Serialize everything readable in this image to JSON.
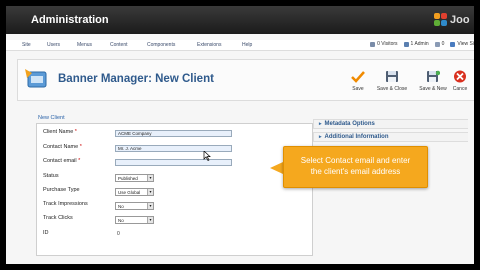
{
  "header": {
    "title": "Administration",
    "logo_text": "Joo"
  },
  "menu": {
    "items": [
      "Site",
      "Users",
      "Menus",
      "Content",
      "Components",
      "Extensions",
      "Help"
    ],
    "visitors": "0 Visitors",
    "admins": "1 Admin",
    "messages": "0",
    "view_site": "View Si"
  },
  "toolbar": {
    "title": "Banner Manager: New Client",
    "save": "Save",
    "save_close": "Save & Close",
    "save_new": "Save & New",
    "cancel": "Cance"
  },
  "form": {
    "legend": "New Client",
    "client_name_label": "Client Name",
    "client_name_value": "ACME Company",
    "contact_name_label": "Contact Name",
    "contact_name_value": "Mr. J. Acme",
    "contact_email_label": "Contact email",
    "contact_email_value": "",
    "required_mark": "*",
    "status_label": "Status",
    "status_value": "Published",
    "purchase_type_label": "Purchase Type",
    "purchase_type_value": "Use Global",
    "track_impressions_label": "Track Impressions",
    "track_impressions_value": "No",
    "track_clicks_label": "Track Clicks",
    "track_clicks_value": "No",
    "id_label": "ID",
    "id_value": "0"
  },
  "panels": {
    "metadata": "Metadata Options",
    "additional": "Additional Information"
  },
  "tooltip": {
    "line1": "Select Contact email and enter",
    "line2": "the client's email address"
  },
  "colors": {
    "accent": "#2f5a8c",
    "tooltip": "#f5a81e",
    "required": "#cc0000"
  }
}
